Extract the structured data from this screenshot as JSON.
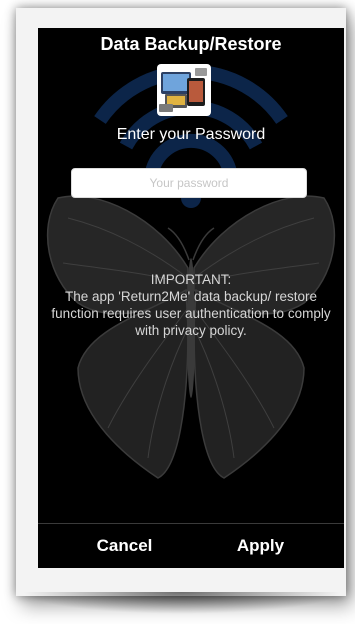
{
  "dialog": {
    "title": "Data Backup/Restore",
    "app_icon": "devices-collage-icon",
    "prompt": "Enter your Password",
    "password": {
      "value": "",
      "placeholder": "Your password"
    },
    "notice_heading": "IMPORTANT:",
    "notice_body": "The app 'Return2Me' data backup/ restore function requires user authentication to comply with privacy policy.",
    "cancel_label": "Cancel",
    "apply_label": "Apply",
    "background_art": [
      "wifi-signal-icon",
      "butterfly-icon"
    ]
  },
  "colors": {
    "screen_background": "#000000",
    "text": "#ffffff",
    "wifi_watermark": "#0e2a52",
    "butterfly": "#2a2a2a"
  }
}
